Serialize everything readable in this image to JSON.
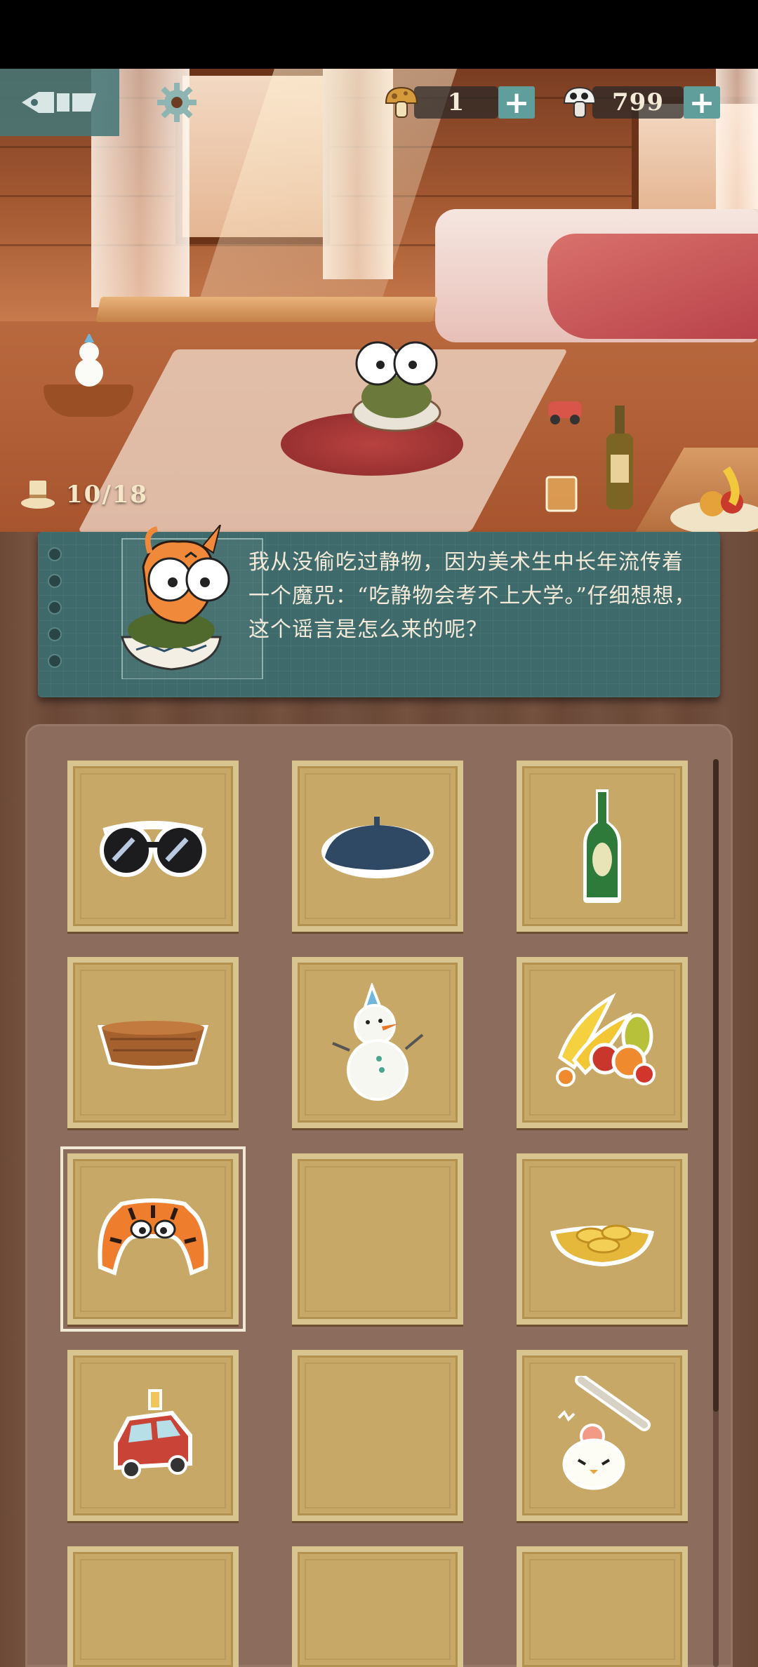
{
  "hud": {
    "currency_a": {
      "value": "1",
      "icon": "brown-mushroom-icon"
    },
    "currency_b": {
      "value": "799",
      "icon": "white-mushroom-icon"
    },
    "plus_label": "+"
  },
  "progress": {
    "text": "10/18",
    "icon": "top-hat-icon"
  },
  "dialog": {
    "text": "我从没偷吃过静物，因为美术生中长年流传着一个魔咒：“吃静物会考不上大学。”仔细想想，这个谣言是怎么来的呢？"
  },
  "inventory": {
    "slots": [
      {
        "item": "sunglasses",
        "filled": true
      },
      {
        "item": "beret",
        "filled": true
      },
      {
        "item": "green-bottle",
        "filled": true
      },
      {
        "item": "wicker-basket",
        "filled": true
      },
      {
        "item": "snowman",
        "filled": true
      },
      {
        "item": "fruit-pile",
        "filled": true
      },
      {
        "item": "tiger-hood",
        "filled": true,
        "selected": true
      },
      {
        "item": "empty",
        "filled": false
      },
      {
        "item": "gold-ingots",
        "filled": true
      },
      {
        "item": "toy-car",
        "filled": true
      },
      {
        "item": "empty",
        "filled": false
      },
      {
        "item": "egg-chick-stick",
        "filled": true
      },
      {
        "item": "empty",
        "filled": false
      },
      {
        "item": "empty",
        "filled": false
      },
      {
        "item": "empty",
        "filled": false
      }
    ]
  },
  "colors": {
    "teal": "#3f6a6b",
    "slot": "#c7a866",
    "wood": "#6c4a38"
  }
}
